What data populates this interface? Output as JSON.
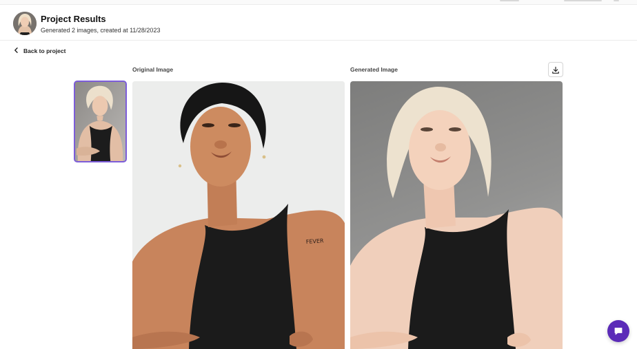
{
  "header": {
    "title": "Project Results",
    "subtitle": "Generated 2 images, created at 11/28/2023"
  },
  "nav": {
    "back_label": "Back to project"
  },
  "comparison": {
    "original_label": "Original Image",
    "generated_label": "Generated Image",
    "tattoo_text": "FEVER"
  },
  "icons": {
    "back": "chevron-left-icon",
    "download": "download-icon",
    "chat": "chat-bubble-icon"
  },
  "colors": {
    "accent": "#7c5cd9",
    "chat_button": "#5b2bb8"
  }
}
